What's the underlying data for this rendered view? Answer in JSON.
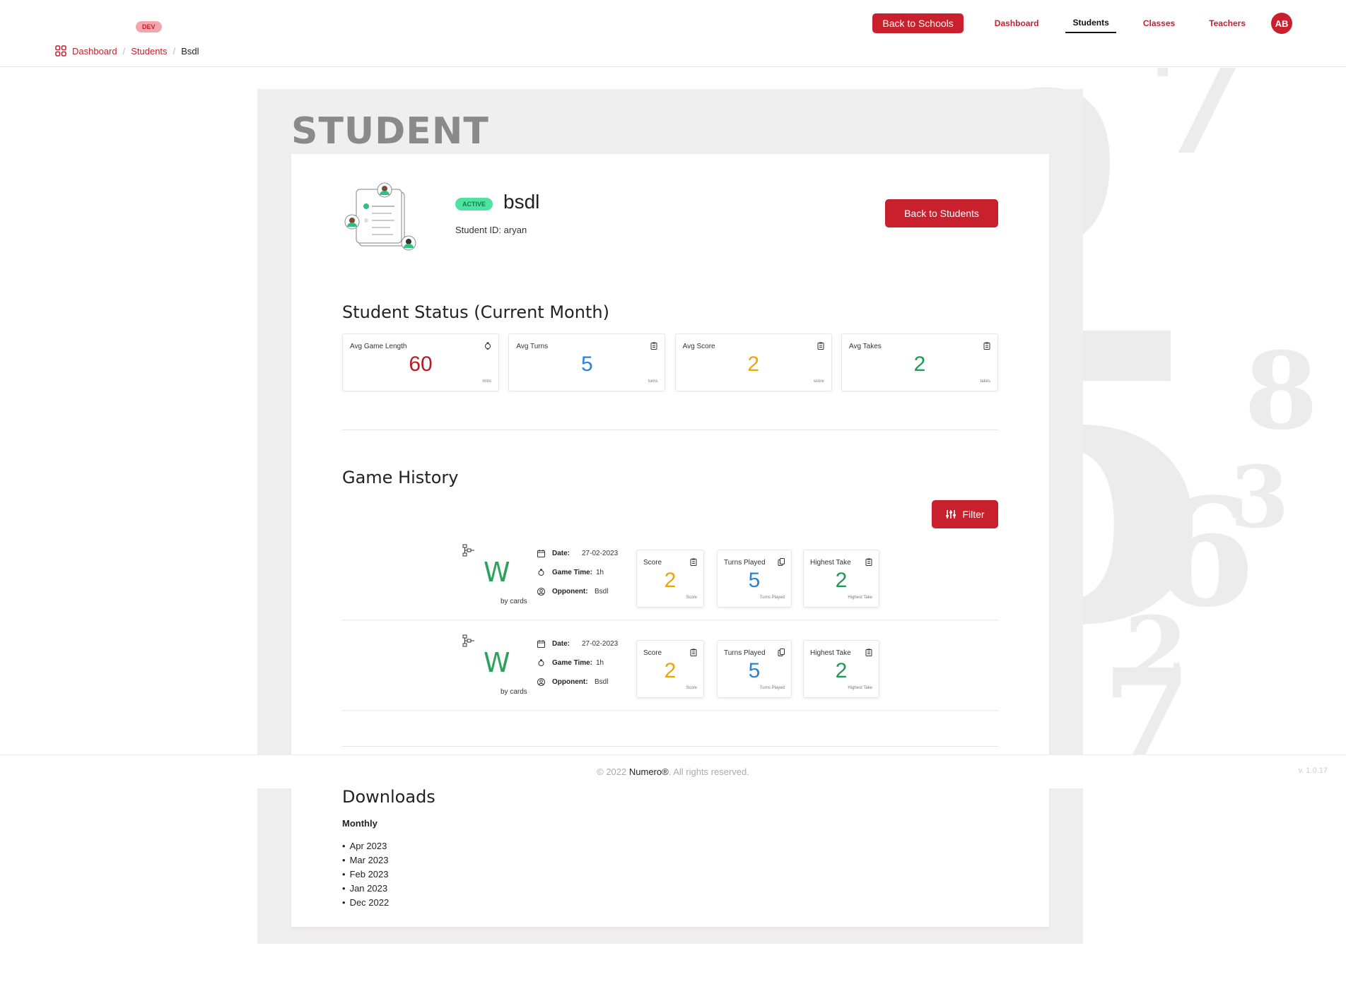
{
  "header": {
    "env_badge": "DEV",
    "back_to_schools": "Back to Schools",
    "nav": [
      "Dashboard",
      "Students",
      "Classes",
      "Teachers"
    ],
    "active_nav": "Students",
    "avatar_initials": "AB"
  },
  "breadcrumb": {
    "dashboard": "Dashboard",
    "students": "Students",
    "current": "Bsdl"
  },
  "page": {
    "title": "STUDENT"
  },
  "student": {
    "status": "ACTIVE",
    "name": "bsdl",
    "id_line": "Student ID: aryan",
    "back_to_students": "Back to Students"
  },
  "status_section": {
    "title": "Student Status (Current Month)",
    "cards": [
      {
        "label": "Avg Game Length",
        "value": "60",
        "unit": "mins",
        "icon": "clock-icon",
        "color": "#b51c27"
      },
      {
        "label": "Avg Turns",
        "value": "5",
        "unit": "turns",
        "icon": "clipboard-icon",
        "color": "#2f82d2"
      },
      {
        "label": "Avg Score",
        "value": "2",
        "unit": "score",
        "icon": "clipboard-icon",
        "color": "#f0a500"
      },
      {
        "label": "Avg Takes",
        "value": "2",
        "unit": "takes",
        "icon": "clipboard-icon",
        "color": "#1f9a55"
      }
    ]
  },
  "history": {
    "title": "Game History",
    "filter_label": "Filter",
    "games": [
      {
        "result": "W",
        "method": "by cards",
        "date_label": "Date:",
        "date": "27-02-2023",
        "time_label": "Game Time:",
        "time": "1h",
        "opponent_label": "Opponent:",
        "opponent": "Bsdl",
        "score": {
          "label": "Score",
          "value": "2",
          "unit": "Score"
        },
        "turns": {
          "label": "Turns Played",
          "value": "5",
          "unit": "Turns Played"
        },
        "take": {
          "label": "Highest Take",
          "value": "2",
          "unit": "Highest Take"
        }
      },
      {
        "result": "W",
        "method": "by cards",
        "date_label": "Date:",
        "date": "27-02-2023",
        "time_label": "Game Time:",
        "time": "1h",
        "opponent_label": "Opponent:",
        "opponent": "Bsdl",
        "score": {
          "label": "Score",
          "value": "2",
          "unit": "Score"
        },
        "turns": {
          "label": "Turns Played",
          "value": "5",
          "unit": "Turns Played"
        },
        "take": {
          "label": "Highest Take",
          "value": "2",
          "unit": "Highest Take"
        }
      }
    ]
  },
  "downloads": {
    "title": "Downloads",
    "subtitle": "Monthly",
    "items": [
      "Apr 2023",
      "Mar 2023",
      "Feb 2023",
      "Jan 2023",
      "Dec 2022"
    ]
  },
  "footer": {
    "prefix": "© 2022 ",
    "brand": "Numero®",
    "suffix": ". All rights reserved.",
    "version": "v. 1.0.17"
  },
  "colors": {
    "accent": "#c8202c",
    "active_pill": "#4fe3a1",
    "win": "#2ca35a"
  }
}
